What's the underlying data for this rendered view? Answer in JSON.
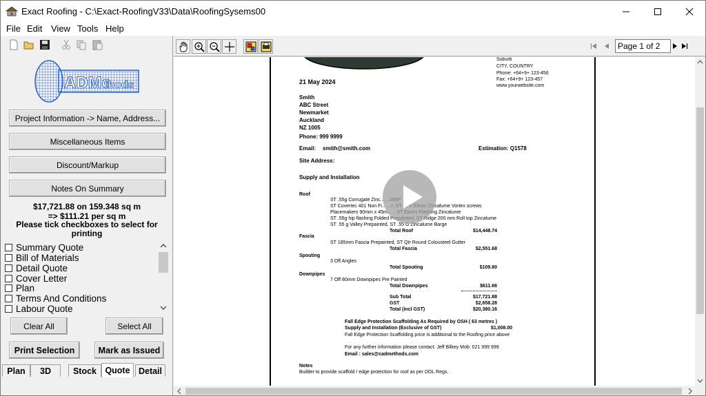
{
  "window": {
    "title": "Exact Roofing - C:\\Exact-RoofingV33\\Data\\RoofingSysems00"
  },
  "menu": [
    "File",
    "Edit",
    "View",
    "Tools",
    "Help"
  ],
  "left": {
    "logo_text": "CADMethods",
    "buttons": {
      "project_info": "Project Information -> Name, Address...",
      "misc_items": "Miscellaneous Items",
      "discount": "Discount/Markup",
      "notes": "Notes On Summary"
    },
    "total_line1": "$17,721.88 on 159.348 sq m",
    "total_line2": "=> $111.21 per  sq m",
    "tick_line1": "Please tick checkboxes to select for",
    "tick_line2": "printing",
    "checklist": [
      "Summary Quote",
      "Bill of Materials",
      "Detail Quote",
      "Cover Letter",
      "Plan",
      "Terms And Conditions",
      "Labour Quote"
    ],
    "clear_all": "Clear All",
    "select_all": "Select All",
    "print_selection": "Print Selection",
    "mark_issued": "Mark as Issued",
    "tabs": [
      "Plan",
      "3D",
      "Stock",
      "Quote",
      "Detail"
    ],
    "active_tab": "Quote"
  },
  "viewer": {
    "page_indicator": "Page 1 of 2"
  },
  "doc": {
    "company": {
      "suburb": "Suburb",
      "city": "CITY, COUNTRY",
      "phone": "Phone: +64+9+ 123-456",
      "fax": "Fax: +64+9+ 123-457",
      "web": "www.yourwebsite.com"
    },
    "date": "21 May 2024",
    "client": [
      "Smith",
      "ABC Street",
      "Newmarket",
      "Auckland",
      "NZ 1005"
    ],
    "phone": "Phone: 999 9999",
    "email_label": "Email:",
    "email": "smith@smith.com",
    "estimation": "Estimation: Q1578",
    "site": "Site Address:",
    "section": "Supply and Installation",
    "roof_label": "Roof",
    "roof_lines": [
      "ST .55g Corrugate Zinc...  ...00M²",
      "ST Covertec 401 Non Fi...                 ...r, ST 12 x 50mm Zincalume Vortex screws",
      "Placemakers 90mm x 45m...              ...ST Eaves Flashing Zincalume",
      "ST .55g hip flashing Folded Prepainted, ST Ridge  200 mm Roll top Zincalume",
      "ST .55 g Valley Prepainted, ST .55 G Zincalume Barge"
    ],
    "total_roof_label": "Total Roof",
    "total_roof": "$14,448.74",
    "fascia_label": "Fascia",
    "fascia_line": "ST 185mm Fascia Prepainted, ST Qtr Round Colousteel Gutter",
    "total_fascia_label": "Total Fascia",
    "total_fascia": "$2,551.68",
    "spouting_label": "Spouting",
    "spouting_line": "3 Off Angles",
    "total_spouting_label": "Total Spouting",
    "total_spouting": "$109.80",
    "downpipes_label": "Downpipes",
    "downpipes_line": "7 Off 80mm Downpipes Pre Painted",
    "total_downpipes_label": "Total Downpipes",
    "total_downpipes": "$611.66",
    "subtotal_label": "Sub Total",
    "subtotal": "$17,721.88",
    "gst_label": "GST",
    "gst": "$2,658.28",
    "total_gst_label": "Total (incl GST)",
    "total_gst": "$20,380.16",
    "fall1": "Fall Edge Protection Scaffolding As Required by OSH     ( 63 metres )",
    "fall2": "Supply and Installation (Exclusive of GST)",
    "fall2_amt": "$1,008.00",
    "fall3": "Fall Edge Protection Scaffolding price is additional to the Roofing price above",
    "contact": "For any further information please contact: Jeff Bilkey  Mob: 021 999 999",
    "contact_email": "Email : sales@cadmethods.com",
    "notes_label": "Notes",
    "notes_line": "Builder to provide scaffold / edge protection for roof as per DOL Regs."
  },
  "colors": {
    "window_bg": "#f0f0f0",
    "viewer_bg": "#ffffff",
    "logo_blue": "#3a7bd5"
  }
}
